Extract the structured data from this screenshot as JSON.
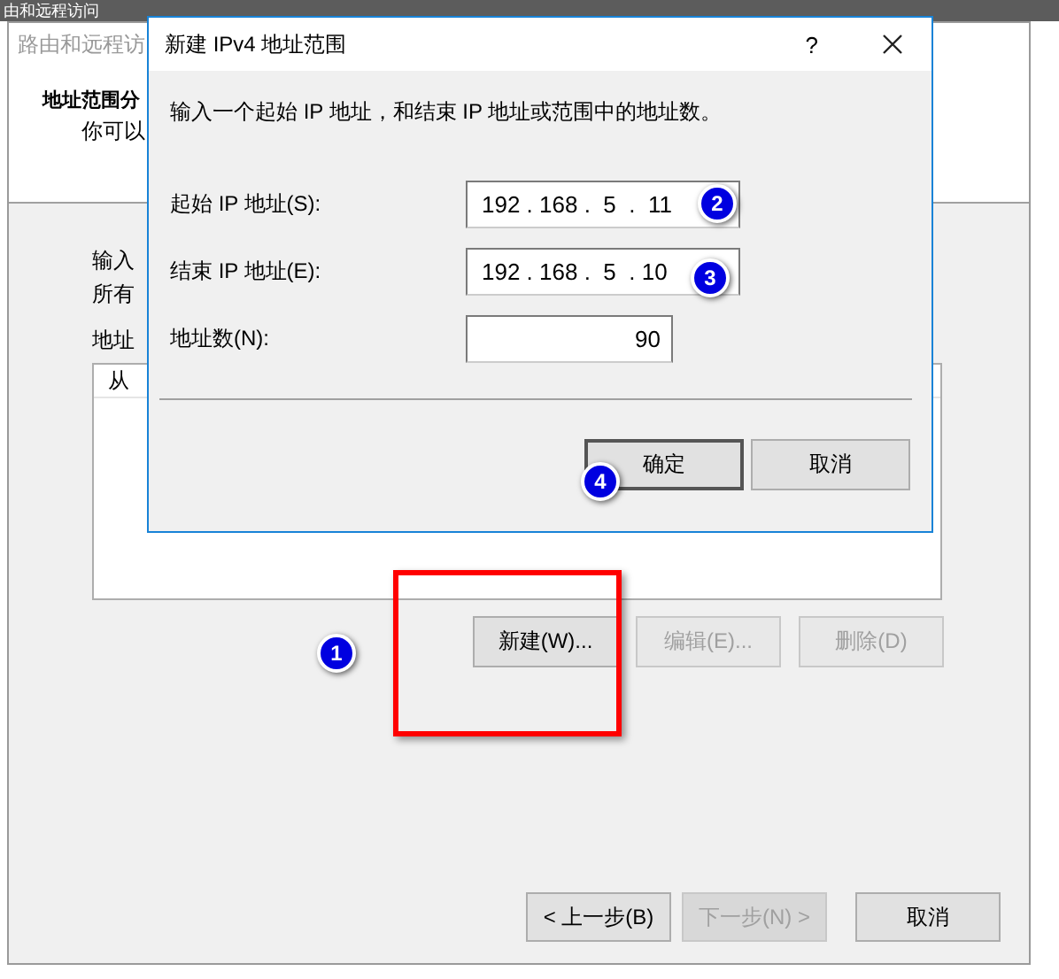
{
  "app_title": "由和远程访问",
  "wizard": {
    "title": "路由和远程访",
    "heading": "地址范围分",
    "subheading": "你可以",
    "intro_line_1": "输入",
    "intro_line_2": "所有",
    "list_label": "地址",
    "list_columns": [
      "从"
    ],
    "buttons": [
      {
        "label": "新建(W)...",
        "disabled": false
      },
      {
        "label": "编辑(E)...",
        "disabled": true
      },
      {
        "label": "删除(D)",
        "disabled": true
      }
    ],
    "nav_buttons": [
      {
        "label": "< 上一步(B)",
        "disabled": false
      },
      {
        "label": "下一步(N) >",
        "disabled": true
      },
      {
        "label": "取消",
        "disabled": false
      }
    ]
  },
  "dialog": {
    "title": "新建 IPv4 地址范围",
    "help": "?",
    "instruction": "输入一个起始 IP 地址，和结束 IP 地址或范围中的地址数。",
    "fields": [
      {
        "label": "起始 IP 地址(S):",
        "kind": "ip",
        "value": "192 . 168 .  5  .  11"
      },
      {
        "label": "结束 IP 地址(E):",
        "kind": "ip",
        "value": "192 . 168 .  5  . 10"
      },
      {
        "label": "地址数(N):",
        "kind": "number",
        "value": "90"
      }
    ],
    "buttons": [
      {
        "label": "确定",
        "default": true
      },
      {
        "label": "取消",
        "default": false
      }
    ]
  },
  "annotations": [
    {
      "label": "1"
    },
    {
      "label": "2"
    },
    {
      "label": "3"
    },
    {
      "label": "4"
    }
  ]
}
